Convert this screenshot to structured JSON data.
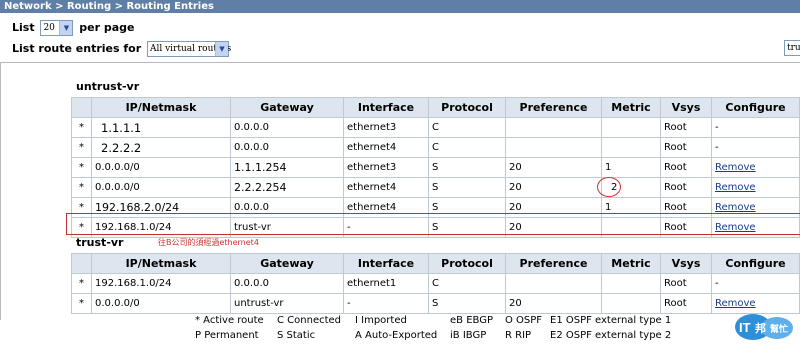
{
  "breadcrumb": "Network > Routing > Routing Entries",
  "controls": {
    "list_prefix": "List",
    "list_count": "20",
    "list_suffix": "per page",
    "vr_prefix": "List route entries for",
    "vr_selected": "All virtual routers",
    "search_value": "trus"
  },
  "columns": [
    "IP/Netmask",
    "Gateway",
    "Interface",
    "Protocol",
    "Preference",
    "Metric",
    "Vsys",
    "Configure"
  ],
  "sections": [
    {
      "title": "untrust-vr",
      "rows": [
        {
          "flag": "*",
          "ip": "1.1.1.1",
          "gateway": "0.0.0.0",
          "interface": "ethernet3",
          "protocol": "C",
          "preference": "",
          "metric": "",
          "vsys": "Root",
          "configure": "-"
        },
        {
          "flag": "*",
          "ip": "2.2.2.2",
          "gateway": "0.0.0.0",
          "interface": "ethernet4",
          "protocol": "C",
          "preference": "",
          "metric": "",
          "vsys": "Root",
          "configure": "-"
        },
        {
          "flag": "*",
          "ip": "0.0.0.0/0",
          "gateway": "1.1.1.254",
          "interface": "ethernet3",
          "protocol": "S",
          "preference": "20",
          "metric": "1",
          "vsys": "Root",
          "configure": "Remove"
        },
        {
          "flag": "*",
          "ip": "0.0.0.0/0",
          "gateway": "2.2.2.254",
          "interface": "ethernet4",
          "protocol": "S",
          "preference": "20",
          "metric": "2",
          "vsys": "Root",
          "configure": "Remove"
        },
        {
          "flag": "*",
          "ip": "192.168.2.0/24",
          "gateway": "0.0.0.0",
          "interface": "ethernet4",
          "protocol": "S",
          "preference": "20",
          "metric": "1",
          "vsys": "Root",
          "configure": "Remove"
        },
        {
          "flag": "*",
          "ip": "192.168.1.0/24",
          "gateway": "trust-vr",
          "interface": "-",
          "protocol": "S",
          "preference": "20",
          "metric": "",
          "vsys": "Root",
          "configure": "Remove"
        }
      ]
    },
    {
      "title": "trust-vr",
      "rows": [
        {
          "flag": "*",
          "ip": "192.168.1.0/24",
          "gateway": "0.0.0.0",
          "interface": "ethernet1",
          "protocol": "C",
          "preference": "",
          "metric": "",
          "vsys": "Root",
          "configure": "-"
        },
        {
          "flag": "*",
          "ip": "0.0.0.0/0",
          "gateway": "untrust-vr",
          "interface": "-",
          "protocol": "S",
          "preference": "20",
          "metric": "",
          "vsys": "Root",
          "configure": "Remove"
        }
      ]
    }
  ],
  "annotation": "往B公司的須經過ethernet4",
  "legend": [
    [
      "* Active route",
      "C Connected",
      "I Imported",
      "eB EBGP",
      "O OSPF",
      "E1 OSPF external type 1"
    ],
    [
      "P Permanent",
      "S Static",
      "A Auto-Exported",
      "iB IBGP",
      "R RIP",
      "E2 OSPF external type 2"
    ]
  ],
  "watermark": {
    "main": "IT",
    "sub": "邦",
    "tag": "幫忙"
  },
  "colors": {
    "header_bar": "#5f7fa6",
    "table_header": "#dde5ee",
    "annotation_red": "#d03030",
    "link": "#1a3c8a"
  }
}
